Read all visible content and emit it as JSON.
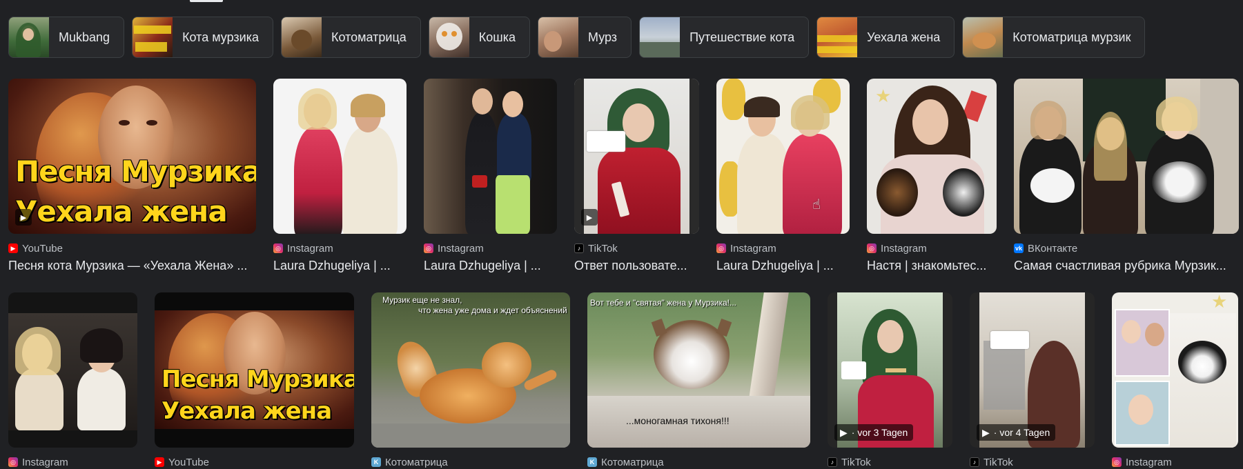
{
  "chips": [
    {
      "label": "Mukbang",
      "thumb": "linear-gradient(180deg,#8fa07a 0%,#3f6b3a 60%,#2a4a26 100%)"
    },
    {
      "label": "Кота мурзика",
      "thumb": "linear-gradient(135deg,#e0b43a 0%,#8a2a1a 55%,#2a1a10 100%)"
    },
    {
      "label": "Котоматрица",
      "thumb": "linear-gradient(160deg,#d9c8b0 0%,#7a5a3a 60%,#3a2a1a 100%)"
    },
    {
      "label": "Кошка",
      "thumb": "linear-gradient(160deg,#c8b8a8 0%,#8a7060 50%,#40302a 100%)"
    },
    {
      "label": "Мурз",
      "thumb": "linear-gradient(160deg,#d8c0a8 0%,#a07860 50%,#5a4030 100%)"
    },
    {
      "label": "Путешествие кота",
      "thumb": "linear-gradient(180deg,#9fb0c8 0%,#c8d0d8 50%,#6a7a6a 100%)"
    },
    {
      "label": "Уехала жена",
      "thumb": "linear-gradient(160deg,#e08a40 0%,#c05a30 50%,#f0c030 100%)"
    },
    {
      "label": "Котоматрица мурзик",
      "thumb": "linear-gradient(160deg,#b8c0b0 0%,#c08a50 50%,#6a7050 100%)"
    }
  ],
  "row1": [
    {
      "source": "YouTube",
      "icon": "youtube-icon",
      "title": "Песня кота Мурзика — «Уехала Жена» ...",
      "caption_1": "Песня Мурзика",
      "caption_2": "Уехала жена"
    },
    {
      "source": "Instagram",
      "icon": "instagram-icon",
      "title": "Laura Dzhugeliya | ..."
    },
    {
      "source": "Instagram",
      "icon": "instagram-icon",
      "title": "Laura Dzhugeliya | ..."
    },
    {
      "source": "TikTok",
      "icon": "tiktok-icon",
      "title": "Ответ пользовате..."
    },
    {
      "source": "Instagram",
      "icon": "instagram-icon",
      "title": "Laura Dzhugeliya | ..."
    },
    {
      "source": "Instagram",
      "icon": "instagram-icon",
      "title": "Настя | знакомьтес..."
    },
    {
      "source": "ВКонтакте",
      "icon": "vk-icon",
      "title": "Самая счастливая рубрика Мурзик..."
    }
  ],
  "row2": [
    {
      "source": "Instagram",
      "icon": "instagram-icon"
    },
    {
      "source": "YouTube",
      "icon": "youtube-icon",
      "caption_1": "Песня Мурзика",
      "caption_2": "Уехала жена"
    },
    {
      "source": "Котоматрица",
      "icon": "kotomatrica-icon",
      "meme_top_1": "Мурзик еще не знал,",
      "meme_top_2": "что жена уже дома и ждет объяснений"
    },
    {
      "source": "Котоматрица",
      "icon": "kotomatrica-icon",
      "meme_top_1": "Вот тебе и \"святая\" жена у Мурзика!...",
      "meme_bottom": "...моногамная тихоня!!!"
    },
    {
      "source": "TikTok",
      "icon": "tiktok-icon",
      "duration": "· vor 3 Tagen"
    },
    {
      "source": "TikTok",
      "icon": "tiktok-icon",
      "duration": "· vor 4 Tagen"
    },
    {
      "source": "Instagram",
      "icon": "instagram-icon"
    }
  ]
}
